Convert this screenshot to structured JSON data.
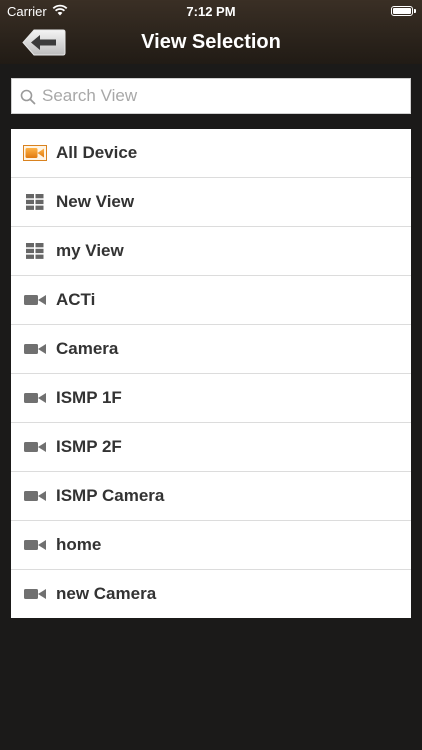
{
  "status_bar": {
    "carrier": "Carrier",
    "time": "7:12 PM"
  },
  "nav": {
    "title": "View Selection",
    "back_icon": "back-arrow-icon"
  },
  "search": {
    "placeholder": "Search View",
    "value": ""
  },
  "colors": {
    "header": "#2c241c",
    "background": "#1b1a19",
    "accent": "#e88a1a"
  },
  "items": [
    {
      "label": "All Device",
      "icon": "all-device-camera-icon"
    },
    {
      "label": "New View",
      "icon": "grid-icon"
    },
    {
      "label": "my View",
      "icon": "grid-icon"
    },
    {
      "label": "ACTi",
      "icon": "camera-icon"
    },
    {
      "label": "Camera",
      "icon": "camera-icon"
    },
    {
      "label": "ISMP 1F",
      "icon": "camera-icon"
    },
    {
      "label": "ISMP 2F",
      "icon": "camera-icon"
    },
    {
      "label": "ISMP Camera",
      "icon": "camera-icon"
    },
    {
      "label": "home",
      "icon": "camera-icon"
    },
    {
      "label": "new Camera",
      "icon": "camera-icon"
    }
  ]
}
